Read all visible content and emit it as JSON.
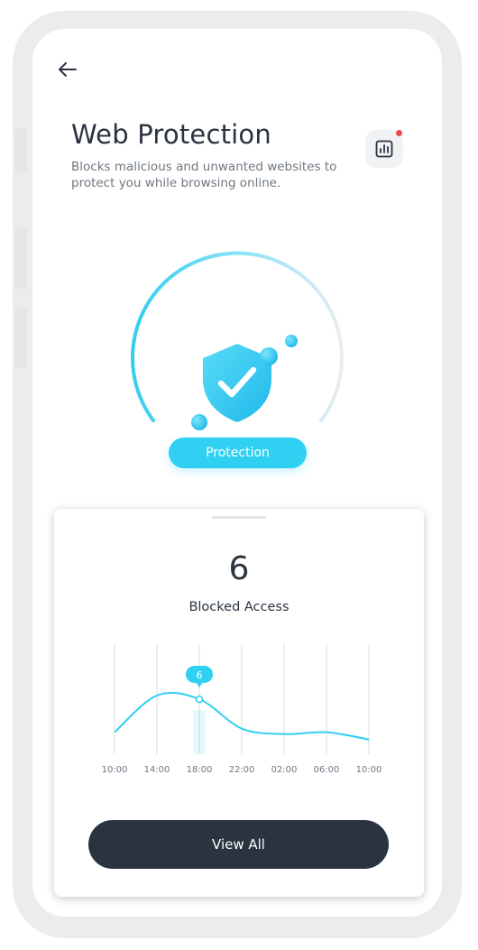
{
  "header": {
    "title": "Web Protection",
    "subtitle": "Blocks malicious and unwanted websites to protect you while browsing online."
  },
  "icons": {
    "back": "arrow-left-icon",
    "stats": "bar-chart-icon",
    "shield": "shield-check-icon"
  },
  "colors": {
    "accent": "#2fd0f2",
    "dark": "#2a3340",
    "notification": "#ef4b4b"
  },
  "protection_button": {
    "label": "Protection"
  },
  "blocked": {
    "count": "6",
    "label": "Blocked Access"
  },
  "chart_data": {
    "type": "line",
    "x": [
      "10:00",
      "14:00",
      "18:00",
      "22:00",
      "02:00",
      "06:00",
      "10:00"
    ],
    "series": [
      {
        "values": [
          1.2,
          3.2,
          3.0,
          1.4,
          1.1,
          1.2,
          0.8
        ]
      }
    ],
    "highlight": {
      "x": "18:00",
      "value": 6,
      "label": "6"
    },
    "grid": true
  },
  "view_all": {
    "label": "View All"
  }
}
